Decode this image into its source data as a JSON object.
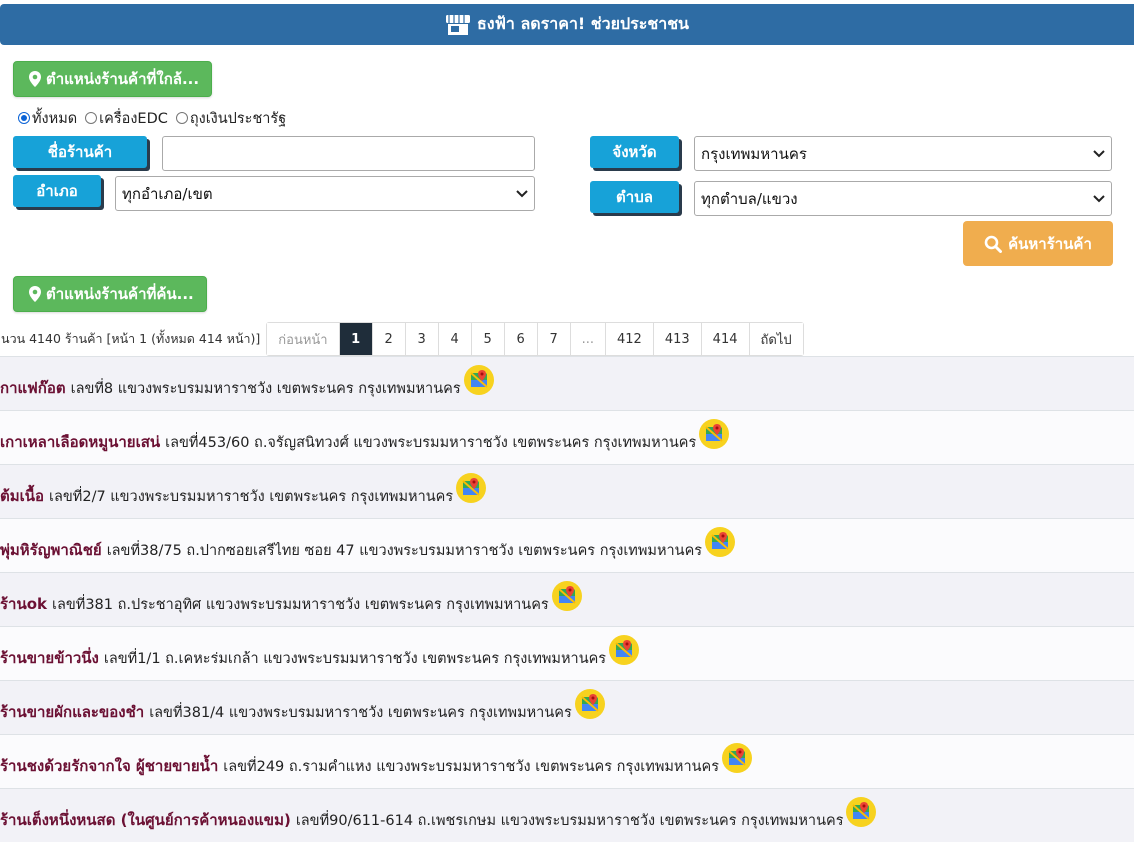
{
  "header": {
    "title": "ธงฟ้า ลดราคา! ช่วยประชาชน",
    "icon": "shop-icon"
  },
  "nearby_button": {
    "label": "ตำแหน่งร้านค้าที่ใกล้..."
  },
  "store_type": {
    "options": [
      "ทั้งหมด",
      "เครื่องEDC",
      "ถุงเงินประชารัฐ"
    ],
    "selected": "ทั้งหมด"
  },
  "filters": {
    "store_name_label": "ชื่อร้านค้า",
    "store_name_value": "",
    "province_label": "จังหวัด",
    "province_value": "กรุงเทพมหานคร",
    "district_label": "อำเภอ",
    "district_value": "ทุกอำเภอ/เขต",
    "subdistrict_label": "ตำบล",
    "subdistrict_value": "ทุกตำบล/แขวง",
    "search_button": "ค้นหาร้านค้า"
  },
  "found_button": {
    "label": "ตำแหน่งร้านค้าที่ค้น..."
  },
  "pagination": {
    "summary": "านวน 4140 ร้านค้า [หน้า 1 (ทั้งหมด 414 หน้า)]",
    "prev": "ก่อนหน้า",
    "pages": [
      "1",
      "2",
      "3",
      "4",
      "5",
      "6",
      "7",
      "...",
      "412",
      "413",
      "414"
    ],
    "current": "1",
    "next": "ถัดไป"
  },
  "stores": [
    {
      "name": "กาแฟก๊อต",
      "address": "เลขที่8 แขวงพระบรมมหาราชวัง เขตพระนคร กรุงเทพมหานคร"
    },
    {
      "name": "เกาเหลาเลือดหมูนายเสน่",
      "address": "เลขที่453/60 ถ.จรัญสนิทวงศ์ แขวงพระบรมมหาราชวัง เขตพระนคร กรุงเทพมหานคร"
    },
    {
      "name": "ต้มเนื้อ",
      "address": "เลขที่2/7 แขวงพระบรมมหาราชวัง เขตพระนคร กรุงเทพมหานคร"
    },
    {
      "name": "พุ่มหิรัญพาณิชย์",
      "address": "เลขที่38/75 ถ.ปากซอยเสรีไทย ซอย 47 แขวงพระบรมมหาราชวัง เขตพระนคร กรุงเทพมหานคร"
    },
    {
      "name": "ร้านok",
      "address": "เลขที่381 ถ.ประชาอุทิศ แขวงพระบรมมหาราชวัง เขตพระนคร กรุงเทพมหานคร"
    },
    {
      "name": "ร้านขายข้าวนึ่ง",
      "address": "เลขที่1/1 ถ.เคหะร่มเกล้า แขวงพระบรมมหาราชวัง เขตพระนคร กรุงเทพมหานคร"
    },
    {
      "name": "ร้านขายผักและของชำ",
      "address": "เลขที่381/4 แขวงพระบรมมหาราชวัง เขตพระนคร กรุงเทพมหานคร"
    },
    {
      "name": "ร้านชงด้วยรักจากใจ ผู้ชายขายน้ำ",
      "address": "เลขที่249 ถ.รามคำแหง แขวงพระบรมมหาราชวัง เขตพระนคร กรุงเทพมหานคร"
    },
    {
      "name": "ร้านเต็งหนึ่งหนสด (ในศูนย์การค้าหนองแขม)",
      "address": "เลขที่90/611-614 ถ.เพชรเกษม แขวงพระบรมมหาราชวัง เขตพระนคร กรุงเทพมหานคร"
    }
  ],
  "colors": {
    "header_bg": "#2e6ca4",
    "green_button": "#5cb85c",
    "label_button": "#17a2d8",
    "search_button": "#f0ad4e",
    "store_name": "#6b1033",
    "active_page": "#1f2d3a"
  }
}
